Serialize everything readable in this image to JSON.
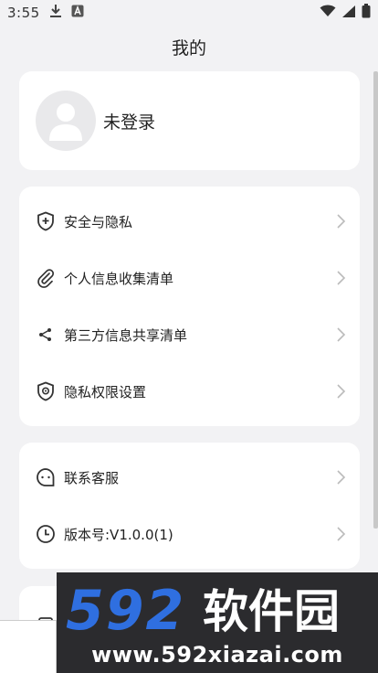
{
  "status_bar": {
    "time": "3:55",
    "left_icons": [
      "download-icon",
      "a-badge-icon"
    ],
    "right_icons": [
      "wifi-icon",
      "signal-icon",
      "battery-icon"
    ]
  },
  "page": {
    "title": "我的"
  },
  "profile": {
    "login_text": "未登录"
  },
  "menu_groups": [
    {
      "items": [
        {
          "label": "安全与隐私",
          "icon": "shield-plus-icon"
        },
        {
          "label": "个人信息收集清单",
          "icon": "paperclip-icon"
        },
        {
          "label": "第三方信息共享清单",
          "icon": "share-icon"
        },
        {
          "label": "隐私权限设置",
          "icon": "shield-gear-icon"
        }
      ]
    },
    {
      "items": [
        {
          "label": "联系客服",
          "icon": "chat-bubble-icon"
        },
        {
          "label": "版本号:V1.0.0(1)",
          "icon": "clock-icon"
        }
      ]
    }
  ],
  "watermark": {
    "brand": "592软件园",
    "url": "www.592xiazai.com",
    "colors": {
      "digits": "#2f6fe0",
      "text": "#ffffff",
      "background": "#2b2b2e"
    }
  }
}
